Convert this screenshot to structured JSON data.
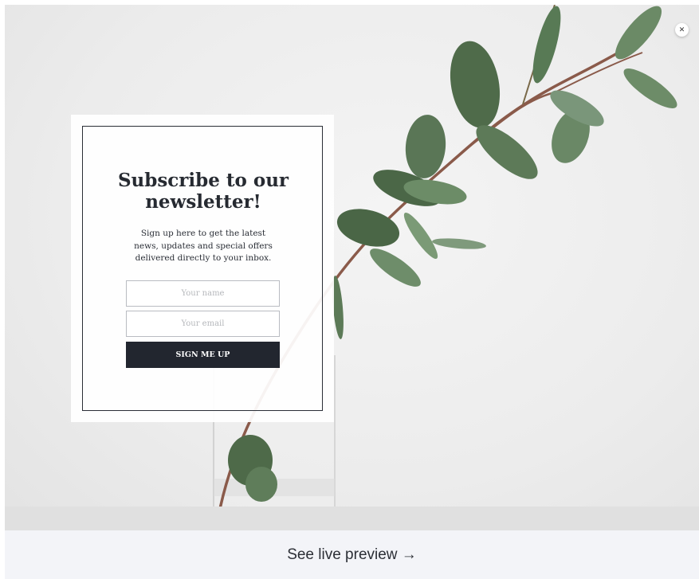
{
  "popup": {
    "title_line1": "Subscribe to our",
    "title_line2": "newsletter!",
    "subtitle": "Sign up here to get the latest news, updates and special offers delivered directly to your inbox.",
    "name_placeholder": "Your name",
    "email_placeholder": "Your email",
    "submit_label": "SIGN ME UP"
  },
  "close": {
    "glyph": "✕",
    "icon": "close-icon"
  },
  "footer": {
    "preview_label": "See live preview →"
  },
  "colors": {
    "button": "#22262f",
    "border": "#2a2e36",
    "leaf": "#4f6b4a",
    "stem": "#8a5a4a"
  }
}
